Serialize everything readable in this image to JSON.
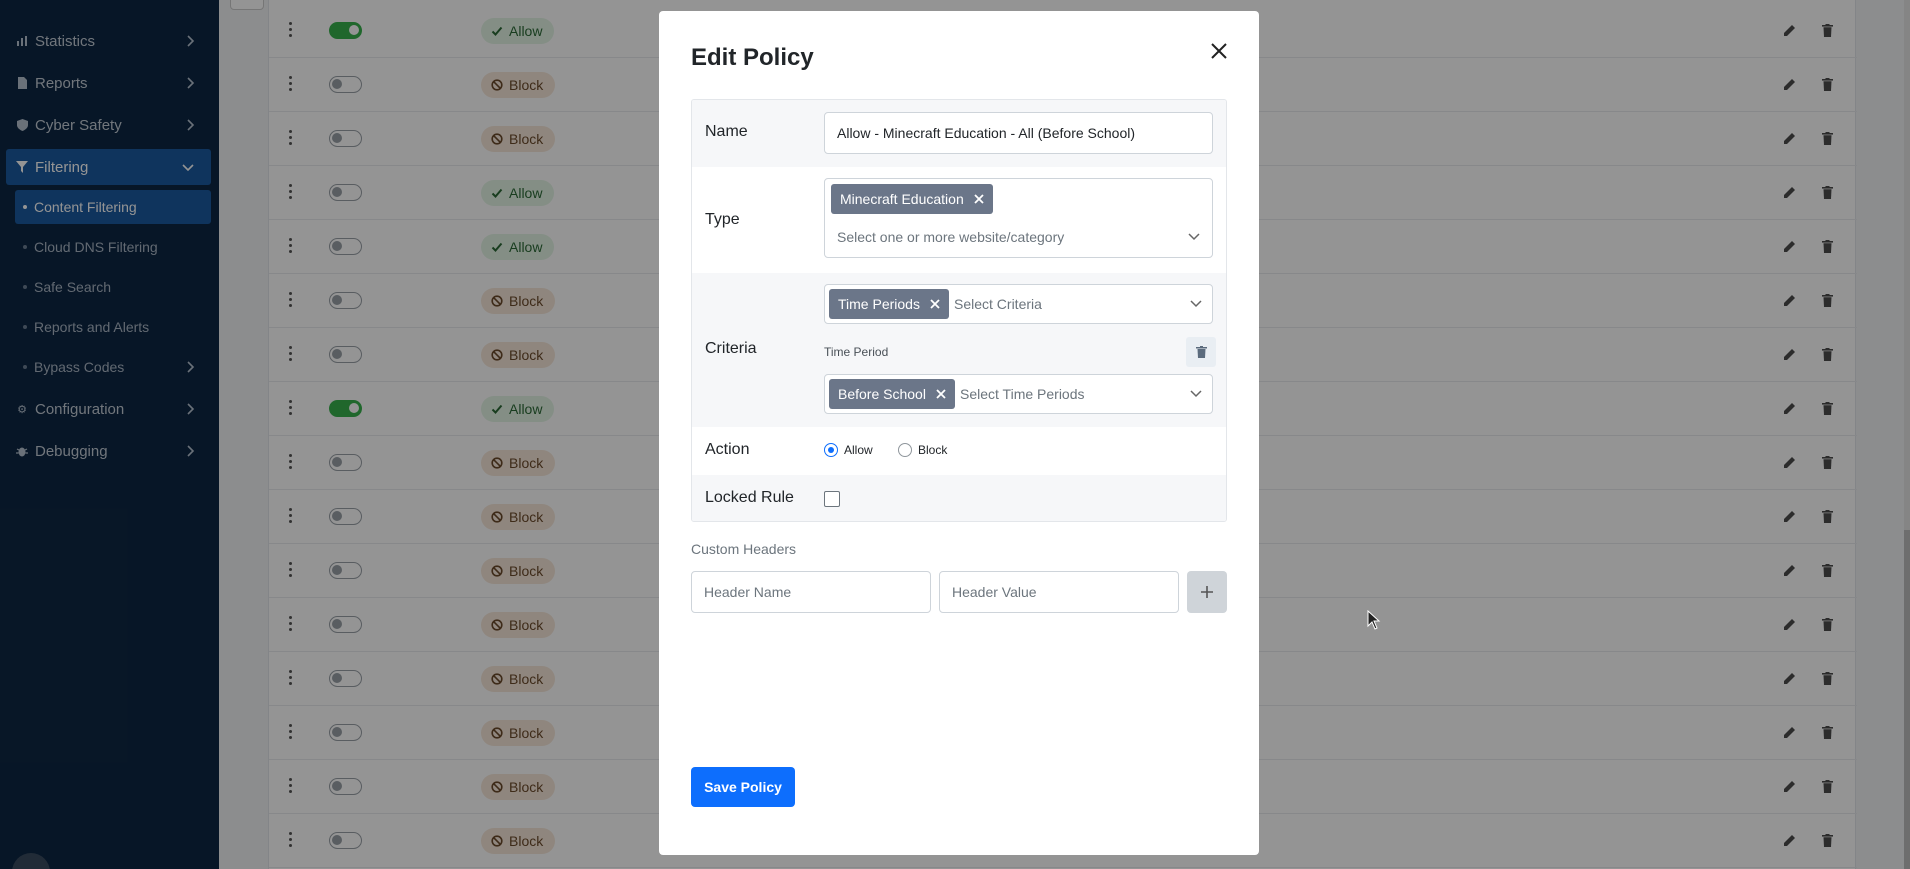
{
  "sidebar": {
    "items": [
      {
        "label": "Statistics",
        "icon": "chart-icon"
      },
      {
        "label": "Reports",
        "icon": "file-icon"
      },
      {
        "label": "Cyber Safety",
        "icon": "shield-icon"
      },
      {
        "label": "Filtering",
        "icon": "filter-icon"
      },
      {
        "label": "Configuration",
        "icon": "gear-icon"
      },
      {
        "label": "Debugging",
        "icon": "bug-icon"
      }
    ],
    "subitems": [
      {
        "label": "Content Filtering"
      },
      {
        "label": "Cloud DNS Filtering"
      },
      {
        "label": "Safe Search"
      },
      {
        "label": "Reports and Alerts"
      },
      {
        "label": "Bypass Codes"
      }
    ]
  },
  "table": {
    "rows": [
      {
        "enabled": true,
        "action": "Allow"
      },
      {
        "enabled": false,
        "action": "Block"
      },
      {
        "enabled": false,
        "action": "Block"
      },
      {
        "enabled": false,
        "action": "Allow"
      },
      {
        "enabled": false,
        "action": "Allow"
      },
      {
        "enabled": false,
        "action": "Block"
      },
      {
        "enabled": false,
        "action": "Block"
      },
      {
        "enabled": true,
        "action": "Allow"
      },
      {
        "enabled": false,
        "action": "Block"
      },
      {
        "enabled": false,
        "action": "Block"
      },
      {
        "enabled": false,
        "action": "Block"
      },
      {
        "enabled": false,
        "action": "Block"
      },
      {
        "enabled": false,
        "action": "Block"
      },
      {
        "enabled": false,
        "action": "Block"
      },
      {
        "enabled": false,
        "action": "Block"
      },
      {
        "enabled": false,
        "action": "Block"
      }
    ]
  },
  "modal": {
    "title": "Edit Policy",
    "name_label": "Name",
    "name_value": "Allow - Minecraft Education - All (Before School)",
    "type_label": "Type",
    "type_chip": "Minecraft Education",
    "type_placeholder": "Select one or more website/category",
    "criteria_label": "Criteria",
    "criteria_chip": "Time Periods",
    "criteria_placeholder": "Select Criteria",
    "time_period_label": "Time Period",
    "time_period_chip": "Before School",
    "time_period_placeholder": "Select Time Periods",
    "action_label": "Action",
    "action_allow": "Allow",
    "action_block": "Block",
    "action_selected": "Allow",
    "locked_label": "Locked Rule",
    "locked_checked": false,
    "custom_headers_label": "Custom Headers",
    "header_name_placeholder": "Header Name",
    "header_value_placeholder": "Header Value",
    "save_label": "Save Policy"
  },
  "colors": {
    "sidebar_bg": "#0d2744",
    "active": "#1b5aa0",
    "primary": "#0d6efd",
    "chip": "#6b7689",
    "allow_badge": "#e3f5e6",
    "block_badge": "#f7e7d9"
  }
}
